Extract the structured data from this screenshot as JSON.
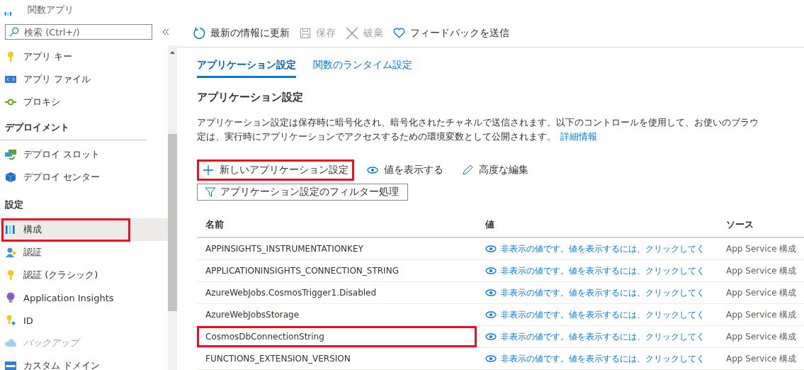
{
  "app": {
    "subtitle": "関数アプリ"
  },
  "search": {
    "placeholder": "検索 (Ctrl+/)"
  },
  "sidebar": {
    "items": [
      {
        "kind": "item",
        "label": "アプリ キー",
        "selected": false,
        "disabled": false,
        "highlighted": false
      },
      {
        "kind": "item",
        "label": "アプリ ファイル",
        "selected": false,
        "disabled": false,
        "highlighted": false
      },
      {
        "kind": "item",
        "label": "プロキシ",
        "selected": false,
        "disabled": false,
        "highlighted": false
      },
      {
        "kind": "header",
        "label": "デプロイメント"
      },
      {
        "kind": "item",
        "label": "デプロイ スロット",
        "selected": false,
        "disabled": false,
        "highlighted": false
      },
      {
        "kind": "item",
        "label": "デプロイ センター",
        "selected": false,
        "disabled": false,
        "highlighted": false
      },
      {
        "kind": "header",
        "label": "設定"
      },
      {
        "kind": "item",
        "label": "構成",
        "selected": true,
        "disabled": false,
        "highlighted": true
      },
      {
        "kind": "item",
        "label": "認証",
        "selected": false,
        "disabled": false,
        "highlighted": false
      },
      {
        "kind": "item",
        "label": "認証 (クラシック)",
        "selected": false,
        "disabled": false,
        "highlighted": false
      },
      {
        "kind": "item",
        "label": "Application Insights",
        "selected": false,
        "disabled": false,
        "highlighted": false
      },
      {
        "kind": "item",
        "label": "ID",
        "selected": false,
        "disabled": false,
        "highlighted": false
      },
      {
        "kind": "item",
        "label": "バックアップ",
        "selected": false,
        "disabled": true,
        "highlighted": false
      },
      {
        "kind": "item",
        "label": "カスタム ドメイン",
        "selected": false,
        "disabled": false,
        "highlighted": false
      }
    ]
  },
  "toolbar": [
    {
      "label": "最新の情報に更新",
      "disabled": false
    },
    {
      "label": "保存",
      "disabled": true
    },
    {
      "label": "破棄",
      "disabled": true
    },
    {
      "label": "フィードバックを送信",
      "disabled": false
    }
  ],
  "tabs": [
    {
      "label": "アプリケーション設定",
      "selected": true
    },
    {
      "label": "関数のランタイム設定",
      "selected": false
    }
  ],
  "heading": "アプリケーション設定",
  "description": {
    "line_1": "アプリケーション設定は保存時に暗号化され、暗号化されたチャネルで送信されます。以下のコントロールを使用して、お使いのブラウ",
    "line_2": "定は、実行時にアプリケーションでアクセスするための環境変数として公開されます。",
    "link": "詳細情報"
  },
  "actions": [
    {
      "label": "新しいアプリケーション設定",
      "highlighted": true
    },
    {
      "label": "値を表示する",
      "highlighted": false
    },
    {
      "label": "高度な編集",
      "highlighted": false
    }
  ],
  "filter": {
    "label": "アプリケーション設定のフィルター処理"
  },
  "table": {
    "columns": [
      "名前",
      "値",
      "ソース"
    ],
    "rows": [
      {
        "name": "APPINSIGHTS_INSTRUMENTATIONKEY",
        "value": "非表示の値です。値を表示するには、クリックしてく",
        "source": "App Service 構成",
        "highlighted": false
      },
      {
        "name": "APPLICATIONINSIGHTS_CONNECTION_STRING",
        "value": "非表示の値です。値を表示するには、クリックしてく",
        "source": "App Service 構成",
        "highlighted": false
      },
      {
        "name": "AzureWebJobs.CosmosTrigger1.Disabled",
        "value": "非表示の値です。値を表示するには、クリックしてく",
        "source": "App Service 構成",
        "highlighted": false
      },
      {
        "name": "AzureWebJobsStorage",
        "value": "非表示の値です。値を表示するには、クリックしてく",
        "source": "App Service 構成",
        "highlighted": false
      },
      {
        "name": "CosmosDbConnectionString",
        "value": "非表示の値です。値を表示するには、クリックしてく",
        "source": "App Service 構成",
        "highlighted": true
      },
      {
        "name": "FUNCTIONS_EXTENSION_VERSION",
        "value": "非表示の値です。値を表示するには、クリックしてく",
        "source": "App Service 構成",
        "highlighted": false
      }
    ]
  }
}
